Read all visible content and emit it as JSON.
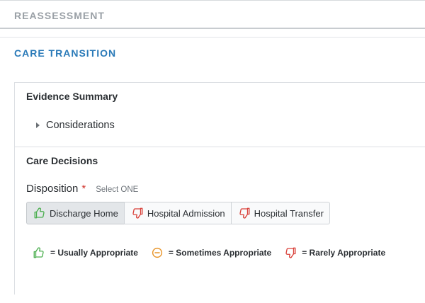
{
  "sections": {
    "reassessment": {
      "title": "REASSESSMENT"
    },
    "care_transition": {
      "title": "CARE TRANSITION"
    }
  },
  "evidence_summary": {
    "title": "Evidence Summary",
    "considerations_label": "Considerations"
  },
  "care_decisions": {
    "title": "Care Decisions",
    "disposition_label": "Disposition",
    "required_marker": "*",
    "select_hint": "Select ONE",
    "options": [
      {
        "label": "Discharge Home",
        "icon": "thumbs-up-icon",
        "selected": true
      },
      {
        "label": "Hospital Admission",
        "icon": "thumbs-down-icon",
        "selected": false
      },
      {
        "label": "Hospital Transfer",
        "icon": "thumbs-down-icon",
        "selected": false
      }
    ]
  },
  "legend": [
    {
      "icon": "thumbs-up-icon",
      "text": "= Usually Appropriate"
    },
    {
      "icon": "minus-circle-icon",
      "text": "= Sometimes Appropriate"
    },
    {
      "icon": "thumbs-down-icon",
      "text": "= Rarely Appropriate"
    }
  ],
  "colors": {
    "accent_blue": "#2a7ab8",
    "thumbs_up": "#4caf50",
    "thumbs_down": "#d9413a",
    "sometimes": "#e8952a",
    "required": "#d0342c"
  }
}
